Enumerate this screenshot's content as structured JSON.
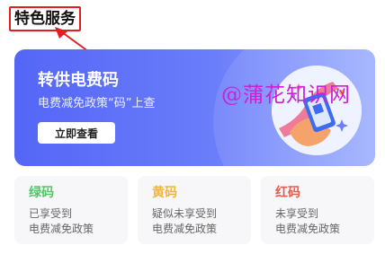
{
  "section": {
    "title": "特色服务"
  },
  "banner": {
    "title": "转供电费码",
    "subtitle": "电费减免政策“码”上查",
    "button": "立即查看"
  },
  "watermark": "@蒲花知识网",
  "cards": [
    {
      "title": "绿码",
      "color": "#58c46a",
      "line1": "已享受到",
      "line2": "电费减免政策"
    },
    {
      "title": "黄码",
      "color": "#f0b53a",
      "line1": "疑似未享受到",
      "line2": "电费减免政策"
    },
    {
      "title": "红码",
      "color": "#e35d4f",
      "line1": "未享受到",
      "line2": "电费减免政策"
    }
  ],
  "colors": {
    "banner_start": "#5466f6",
    "highlight_box": "#e02020"
  }
}
